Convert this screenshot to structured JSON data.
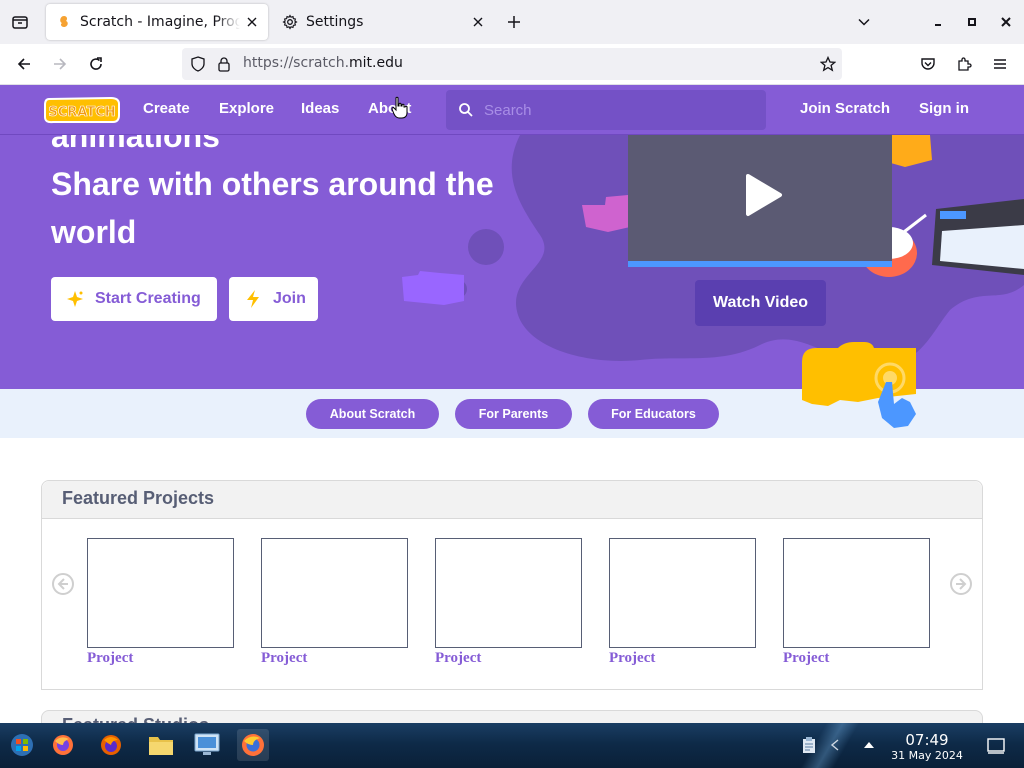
{
  "browser": {
    "tabs": [
      {
        "title": "Scratch - Imagine, Program, Share",
        "icon": "scratch-favicon",
        "active": true
      },
      {
        "title": "Settings",
        "icon": "gear-icon",
        "active": false
      }
    ],
    "url_prefix": "https://scratch.",
    "url_host": "mit.edu"
  },
  "scratch": {
    "logo_text": "SCRATCH",
    "nav": {
      "create": "Create",
      "explore": "Explore",
      "ideas": "Ideas",
      "about": "About",
      "join": "Join Scratch",
      "signin": "Sign in"
    },
    "search_placeholder": "Search",
    "hero": {
      "line_partial": "animations",
      "line_1": "Share with others around the",
      "line_2": "world",
      "start_creating": "Start Creating",
      "join": "Join",
      "watch_video": "Watch Video"
    },
    "subnav": {
      "about": "About Scratch",
      "parents": "For Parents",
      "educators": "For Educators"
    },
    "featured": {
      "title": "Featured Projects",
      "projects": [
        "Project",
        "Project",
        "Project",
        "Project",
        "Project"
      ]
    },
    "studios_title": "Featured Studios"
  },
  "taskbar": {
    "time": "07:49",
    "date": "31 May 2024"
  },
  "colors": {
    "scratch_purple": "#855cd6",
    "subnav_bg": "#e9f1fc",
    "taskbar": "#0e2a48"
  }
}
